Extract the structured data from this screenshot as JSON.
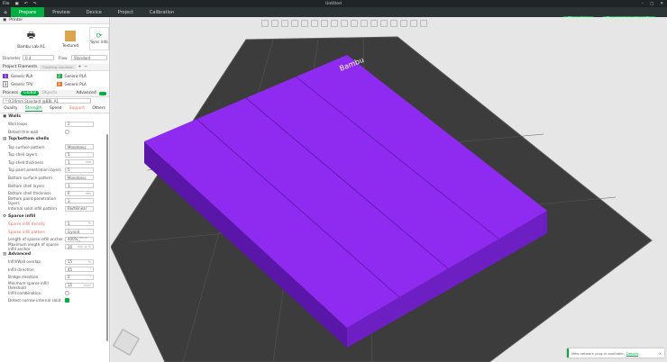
{
  "window": {
    "title": "Untitled",
    "menu": "File"
  },
  "tabs": [
    {
      "label": "Prepare"
    },
    {
      "label": "Preview"
    },
    {
      "label": "Device"
    },
    {
      "label": "Project"
    },
    {
      "label": "Calibration"
    }
  ],
  "top_buttons": {
    "slice": "Slice plate",
    "export": "Export plate sliced file"
  },
  "printer": {
    "header": "Printer",
    "name": "Bambu Lab A1",
    "plate": "Textured",
    "sync": "Sync info",
    "diameter_label": "Diameter",
    "diameter": "0.4",
    "flow_label": "Flow",
    "flow": "Standard"
  },
  "filaments": {
    "header": "Project Filaments",
    "flushing": "Flushing volumes",
    "items": [
      {
        "num": "1",
        "name": "Generic PLA",
        "color": "#8a2be2"
      },
      {
        "num": "2",
        "name": "Generic PLA",
        "color": "#22b14c"
      },
      {
        "num": "3",
        "name": "Generic TPU",
        "color": "#ffffff"
      },
      {
        "num": "4",
        "name": "Generic PLA",
        "color": "#ef7a22"
      }
    ]
  },
  "process": {
    "header": "Process",
    "global": "Global",
    "objects": "Objects",
    "advanced": "Advanced",
    "preset": "* 0.20mm Standard @BBL A1",
    "subtabs": [
      "Quality",
      "Strength",
      "Speed",
      "Support",
      "Others"
    ]
  },
  "walls": {
    "title": "Walls",
    "rows": [
      {
        "label": "Wall loops",
        "value": "2"
      },
      {
        "label": "Detect thin wall"
      }
    ]
  },
  "shells": {
    "title": "Top/bottom shells",
    "rows": [
      {
        "label": "Top surface pattern",
        "value": "Monotonic"
      },
      {
        "label": "Top shell layers",
        "value": "5"
      },
      {
        "label": "Top shell thickness",
        "value": "1",
        "unit": "mm"
      },
      {
        "label": "Top paint penetration layers",
        "value": "5"
      },
      {
        "label": "Bottom surface pattern",
        "value": "Monotonic"
      },
      {
        "label": "Bottom shell layers",
        "value": "3"
      },
      {
        "label": "Bottom shell thickness",
        "value": "0",
        "unit": "mm"
      },
      {
        "label": "Bottom paint penetration layers",
        "value": "3"
      },
      {
        "label": "Internal solid infill pattern",
        "value": "Rectilinear"
      }
    ]
  },
  "infill": {
    "title": "Sparse infill",
    "rows": [
      {
        "label": "Sparse infill density",
        "value": "5",
        "unit": "%"
      },
      {
        "label": "Sparse infill pattern",
        "value": "Gyroid"
      },
      {
        "label": "Length of sparse infill anchor",
        "value": "400%",
        "unit": "mm or %"
      },
      {
        "label": "Maximum length of sparse infill anchor",
        "value": "20",
        "unit": "mm or %"
      }
    ]
  },
  "advanced": {
    "title": "Advanced",
    "rows": [
      {
        "label": "Infill/Wall overlap",
        "value": "15",
        "unit": "%"
      },
      {
        "label": "Infill direction",
        "value": "45",
        "unit": "°"
      },
      {
        "label": "Bridge direction",
        "value": "0",
        "unit": "°"
      },
      {
        "label": "Minimum sparse infill threshold",
        "value": "15",
        "unit": "mm²"
      },
      {
        "label": "Infill combination"
      },
      {
        "label": "Detect narrow internal solid"
      }
    ]
  },
  "toast": {
    "text": "New network plug-in available.",
    "link": "Details"
  },
  "colors": {
    "accent": "#00ae42",
    "model": "#8f2bf0"
  }
}
